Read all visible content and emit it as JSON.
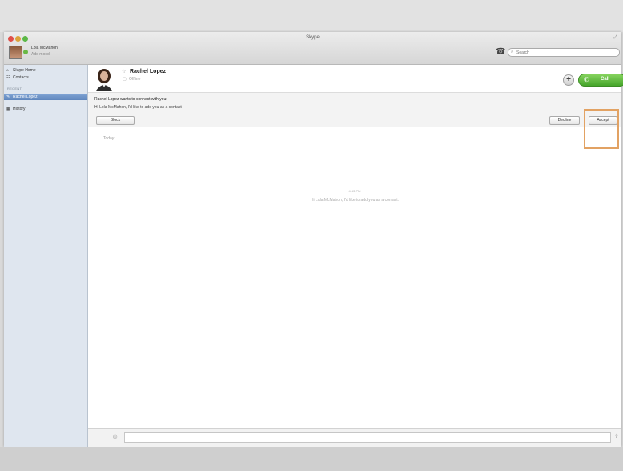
{
  "window": {
    "title": "Skype"
  },
  "user": {
    "name": "Lola McMahon",
    "mood": "Add mood"
  },
  "search": {
    "placeholder": "Search"
  },
  "sidebar": {
    "items": [
      {
        "label": "Skype Home",
        "icon": "home-icon"
      },
      {
        "label": "Contacts",
        "icon": "contacts-icon"
      },
      {
        "label": "Rachel Lopez",
        "icon": "contact-icon"
      },
      {
        "label": "History",
        "icon": "history-icon"
      }
    ],
    "recent_heading": "RECENT"
  },
  "contact": {
    "name": "Rachel Lopez",
    "status": "Offline"
  },
  "call": {
    "label": "Call"
  },
  "request": {
    "title": "Rachel Lopez wants to connect with you:",
    "message": "Hi Lola McMahon, I'd like to add you as a contact",
    "block_label": "Block",
    "decline_label": "Decline",
    "accept_label": "Accept"
  },
  "conversation": {
    "date_divider": "Today",
    "message_time": "4:53 PM",
    "message_text": "Hi Lola McMahon, I'd like to add you as a contact."
  },
  "colors": {
    "call_green": "#46a52b",
    "selection_blue": "#6a8fc5",
    "highlight_orange": "#e2a263"
  }
}
